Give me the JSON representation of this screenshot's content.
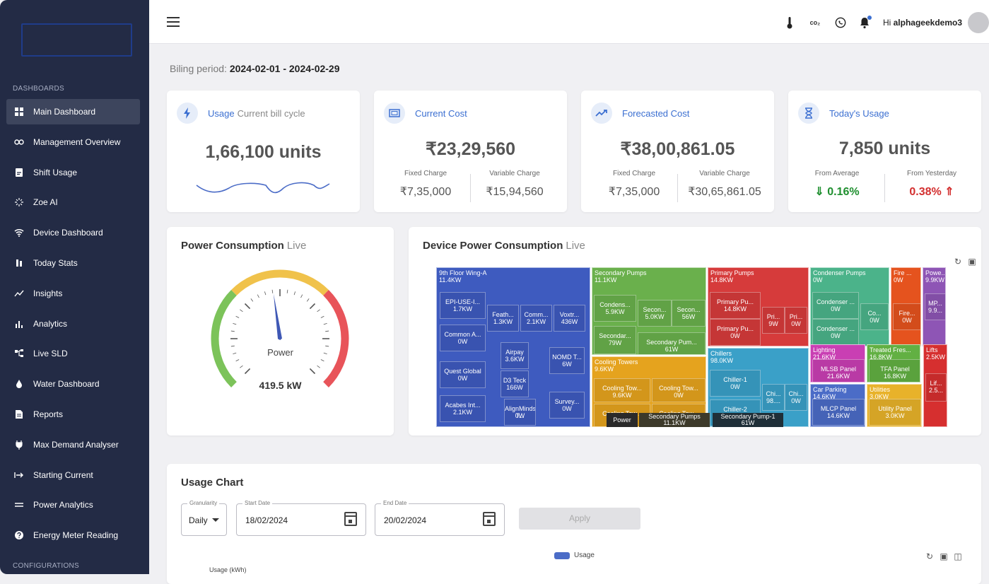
{
  "sidebar": {
    "section_dashboards": "DASHBOARDS",
    "section_configurations": "CONFIGURATIONS",
    "items": [
      {
        "label": "Main Dashboard",
        "icon": "grid-icon",
        "active": true
      },
      {
        "label": "Management Overview",
        "icon": "infinity-icon"
      },
      {
        "label": "Shift Usage",
        "icon": "clipboard-icon"
      },
      {
        "label": "Zoe AI",
        "icon": "sparkle-icon"
      },
      {
        "label": "Device Dashboard",
        "icon": "wifi-icon"
      },
      {
        "label": "Today Stats",
        "icon": "pause-bars-icon"
      },
      {
        "label": "Insights",
        "icon": "trend-icon"
      },
      {
        "label": "Analytics",
        "icon": "bar-chart-icon"
      },
      {
        "label": "Live SLD",
        "icon": "diagram-icon"
      },
      {
        "label": "Water Dashboard",
        "icon": "drop-icon"
      },
      {
        "label": "Reports",
        "icon": "document-icon"
      },
      {
        "label": "Max Demand Analyser",
        "icon": "plug-icon"
      },
      {
        "label": "Starting Current",
        "icon": "arrow-right-bar-icon"
      },
      {
        "label": "Power Analytics",
        "icon": "lines-icon"
      },
      {
        "label": "Energy Meter Reading",
        "icon": "help-circle-icon"
      }
    ]
  },
  "topbar": {
    "co2_label": "co₂",
    "greeting_prefix": "Hi",
    "username": "alphageekdemo3"
  },
  "billing": {
    "label": "Biling period:",
    "period": "2024-02-01 - 2024-02-29"
  },
  "kpis": {
    "usage": {
      "title": "Usage",
      "title_suffix": "Current bill cycle",
      "value": "1,66,100 units"
    },
    "current_cost": {
      "title": "Current Cost",
      "value": "₹23,29,560",
      "fixed_label": "Fixed Charge",
      "fixed_value": "₹7,35,000",
      "variable_label": "Variable Charge",
      "variable_value": "₹15,94,560"
    },
    "forecasted_cost": {
      "title": "Forecasted Cost",
      "value": "₹38,00,861.05",
      "fixed_label": "Fixed Charge",
      "fixed_value": "₹7,35,000",
      "variable_label": "Variable Charge",
      "variable_value": "₹30,65,861.05"
    },
    "today_usage": {
      "title": "Today's Usage",
      "value": "7,850 units",
      "avg_label": "From Average",
      "avg_value": "0.16%",
      "yest_label": "From Yesterday",
      "yest_value": "0.38%"
    }
  },
  "power_consumption": {
    "title": "Power Consumption",
    "title_suffix": "Live",
    "gauge_label": "Power",
    "gauge_value": "419.5 kW",
    "needle_fraction": 0.47,
    "colors": {
      "low": "#7cc35a",
      "mid": "#f0c24b",
      "high": "#e8545a"
    }
  },
  "device_power": {
    "title": "Device Power Consumption",
    "title_suffix": "Live",
    "breadcrumb": [
      "Power",
      "Secondary Pumps\n11.1KW",
      "Secondary Pump-1\n61W"
    ]
  },
  "treemap": {
    "groups": [
      {
        "name": "9th Floor Wing-A",
        "value": "11.4KW",
        "color": "#3e5bbf",
        "cells": [
          {
            "name": "EPI-USE-I...",
            "value": "1.7KW"
          },
          {
            "name": "Feath...",
            "value": "1.3KW"
          },
          {
            "name": "Comm...",
            "value": "2.1KW"
          },
          {
            "name": "Voxtr...",
            "value": "436W"
          },
          {
            "name": "Common A...",
            "value": "0W"
          },
          {
            "name": "Airpay",
            "value": "3.6KW"
          },
          {
            "name": "NOMD T...",
            "value": "6W"
          },
          {
            "name": "Quest Global",
            "value": "0W"
          },
          {
            "name": "D3 Teck",
            "value": "166W"
          },
          {
            "name": "Acabes Int...",
            "value": "2.1KW"
          },
          {
            "name": "AlignMinds T...",
            "value": "0W"
          },
          {
            "name": "Survey...",
            "value": "0W"
          }
        ]
      },
      {
        "name": "Secondary Pumps",
        "value": "11.1KW",
        "color": "#6ab04c",
        "cells": [
          {
            "name": "Condens...",
            "value": "5.9KW"
          },
          {
            "name": "Secon...",
            "value": "5.0KW"
          },
          {
            "name": "Secon...",
            "value": "56W"
          },
          {
            "name": "Secondar...",
            "value": "79W"
          },
          {
            "name": "Secondary Pum...",
            "value": "61W"
          }
        ]
      },
      {
        "name": "Cooling Towers",
        "value": "9.6KW",
        "color": "#e5a31e",
        "cells": [
          {
            "name": "Cooling Tow...",
            "value": "9.6KW"
          },
          {
            "name": "Cooling Tow...",
            "value": "0W"
          },
          {
            "name": "Cooling Tow...",
            "value": "0W"
          },
          {
            "name": "Cooling Tow...",
            "value": "0W"
          }
        ]
      },
      {
        "name": "Primary Pumps",
        "value": "14.8KW",
        "color": "#d63b3b",
        "cells": [
          {
            "name": "Primary Pu...",
            "value": "14.8KW"
          },
          {
            "name": "Pri...",
            "value": "9W"
          },
          {
            "name": "Pri...",
            "value": "0W"
          },
          {
            "name": "Primary Pu...",
            "value": "0W"
          }
        ]
      },
      {
        "name": "Chillers",
        "value": "98.0KW",
        "color": "#3aa0c8",
        "cells": [
          {
            "name": "Chiller-1",
            "value": "0W"
          },
          {
            "name": "Chi...",
            "value": "98...."
          },
          {
            "name": "Chi...",
            "value": "0W"
          },
          {
            "name": "Chiller-2",
            "value": "0W"
          }
        ]
      },
      {
        "name": "Condenser Pumps",
        "value": "0W",
        "color": "#4bb38a",
        "cells": [
          {
            "name": "Condenser ...",
            "value": "0W"
          },
          {
            "name": "Co...",
            "value": "0W"
          },
          {
            "name": "Condenser ...",
            "value": "0W"
          }
        ]
      },
      {
        "name": "Fire ...",
        "value": "0W",
        "color": "#e5531e",
        "cells": [
          {
            "name": "Fire...",
            "value": "0W"
          }
        ]
      },
      {
        "name": "Powe...",
        "value": "9.9KW",
        "color": "#8e55b5",
        "cells": [
          {
            "name": "MP...",
            "value": "9.9..."
          }
        ]
      },
      {
        "name": "Lighting",
        "value": "21.6KW",
        "color": "#c93fb3",
        "cells": [
          {
            "name": "MLSB Panel",
            "value": "21.6KW"
          }
        ]
      },
      {
        "name": "Treated Fres...",
        "value": "16.8KW",
        "color": "#62b043",
        "cells": [
          {
            "name": "TFA Panel",
            "value": "16.8KW"
          }
        ]
      },
      {
        "name": "Lifts",
        "value": "2.5KW",
        "color": "#d62f2f",
        "cells": [
          {
            "name": "Lif...",
            "value": "2.5..."
          }
        ]
      },
      {
        "name": "Car Parking",
        "value": "14.6KW",
        "color": "#4b6cc7",
        "cells": [
          {
            "name": "MLCP Panel",
            "value": "14.6KW"
          }
        ]
      },
      {
        "name": "Utilities",
        "value": "3.0KW",
        "color": "#e8b22a",
        "cells": [
          {
            "name": "Utility Panel",
            "value": "3.0KW"
          }
        ]
      }
    ]
  },
  "usage_chart": {
    "title": "Usage Chart",
    "granularity_label": "Granularity",
    "granularity_value": "Daily",
    "start_label": "Start Date",
    "start_value": "18/02/2024",
    "end_label": "End Date",
    "end_value": "20/02/2024",
    "apply_label": "Apply",
    "legend": "Usage",
    "legend_color": "#4b6cc7",
    "ylabel": "Usage (kWh)"
  }
}
